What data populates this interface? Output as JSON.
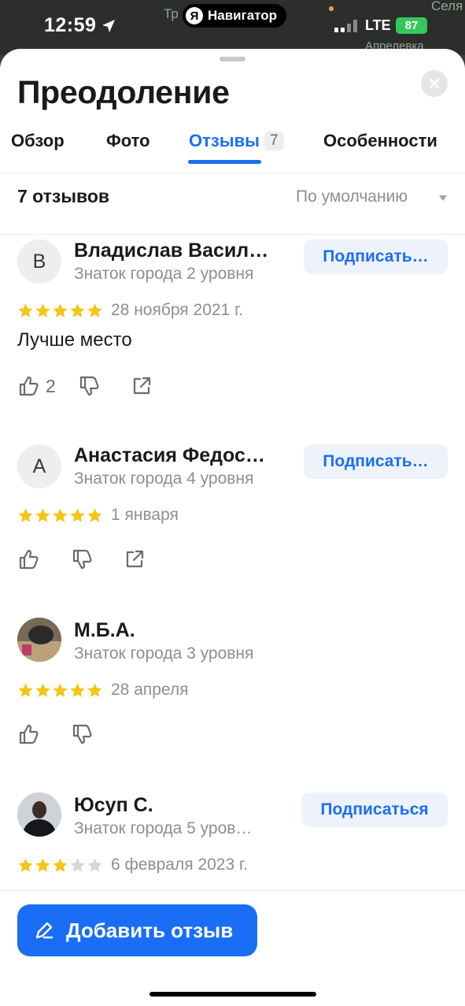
{
  "status_bar": {
    "time": "12:59",
    "network": "LTE",
    "battery": "87",
    "app_pill": {
      "logo": "Я",
      "label": "Навигатор"
    },
    "map_labels": [
      "Тр",
      "Селя",
      "Апрелевка"
    ]
  },
  "place": {
    "title": "Преодоление"
  },
  "tabs": [
    {
      "label": "Обзор",
      "active": false
    },
    {
      "label": "Фото",
      "active": false
    },
    {
      "label": "Отзывы",
      "count": "7",
      "active": true
    },
    {
      "label": "Особенности",
      "active": false
    }
  ],
  "reviews_header": {
    "count_label": "7 отзывов",
    "sort_label": "По умолчанию"
  },
  "reviews": [
    {
      "initial": "В",
      "author": "Владислав Васил…",
      "level": "Знаток города 2 уровня",
      "follow_label": "Подписать…",
      "rating": 5,
      "date": "28 ноября 2021 г.",
      "text": "Лучше место",
      "likes": "2",
      "has_share": true
    },
    {
      "initial": "А",
      "author": "Анастасия Федос…",
      "level": "Знаток города 4 уровня",
      "follow_label": "Подписать…",
      "rating": 5,
      "date": "1 января",
      "text": "",
      "likes": "",
      "has_share": true
    },
    {
      "initial": "",
      "author": "М.Б.А.",
      "level": "Знаток города 3 уровня",
      "follow_label": "",
      "rating": 5,
      "date": "28 апреля",
      "text": "",
      "likes": "",
      "has_share": false
    },
    {
      "initial": "",
      "author": "Юсуп С.",
      "level": "Знаток города 5 уров…",
      "follow_label": "Подписаться",
      "rating": 3,
      "date": "6 февраля 2023 г.",
      "text": "",
      "likes": "",
      "has_share": false
    }
  ],
  "add_review": {
    "label": "Добавить отзыв"
  },
  "colors": {
    "accent": "#1a6ef5",
    "star_filled": "#f5c518",
    "star_empty": "#d6d6da",
    "secondary_text": "#8e8e93"
  },
  "icons": [
    "location-arrow-icon",
    "signal-icon",
    "close-icon",
    "caret-down-icon",
    "star-icon",
    "thumbs-up-icon",
    "thumbs-down-icon",
    "share-icon",
    "pencil-icon"
  ]
}
